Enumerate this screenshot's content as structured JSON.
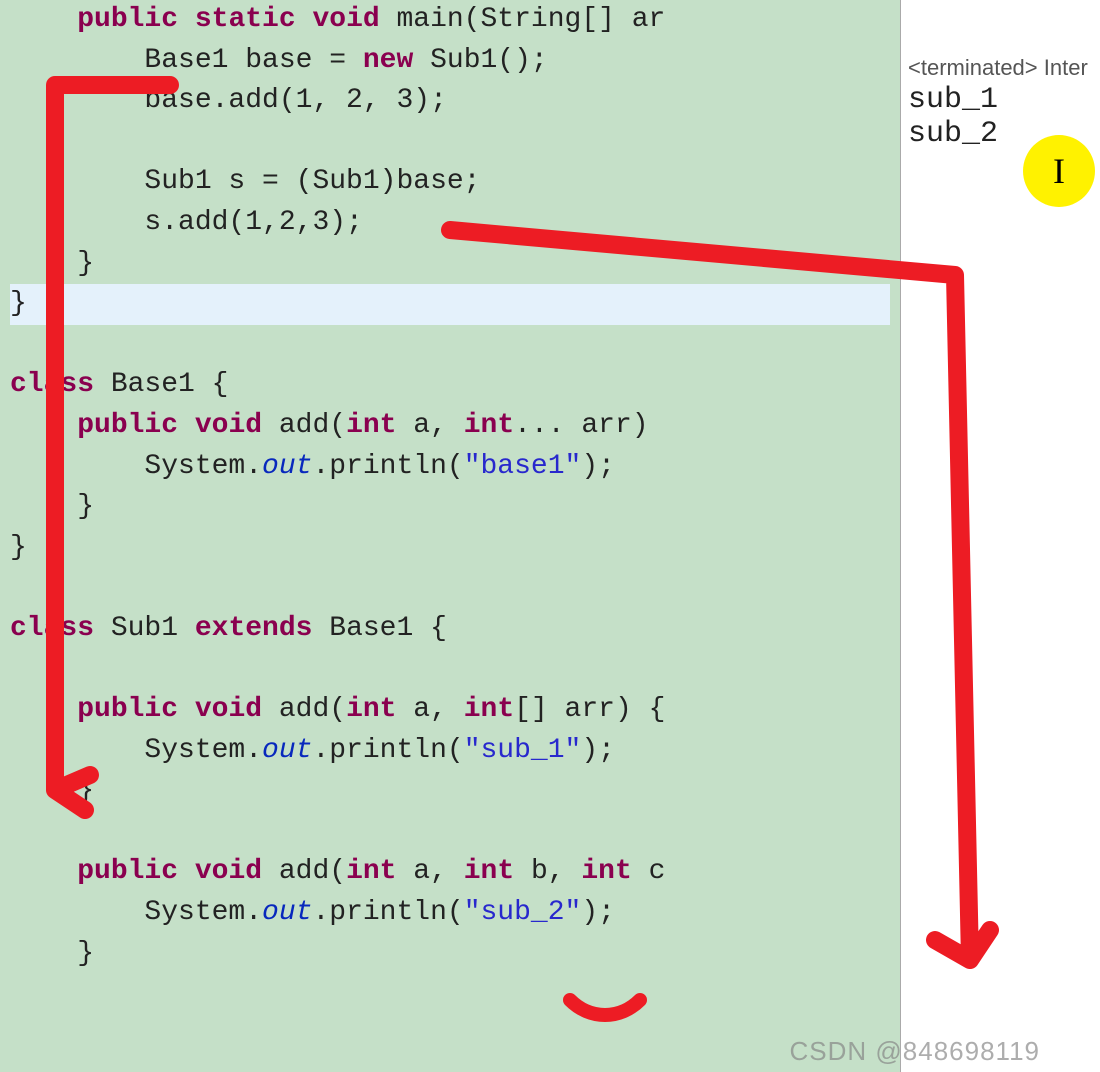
{
  "code": {
    "line1_t1": "    ",
    "line1_kw1": "public static void",
    "line1_t2": " main(String[] ar",
    "line2_t1": "        Base1 base = ",
    "line2_kw1": "new",
    "line2_t2": " Sub1();",
    "line3_t1": "        base.add(1, 2, 3);",
    "line4_t1": "",
    "line5_t1": "        Sub1 s = (Sub1)base;",
    "line6_t1": "        s.add(1,2,3);",
    "line7_t1": "    }",
    "line8_t1": "}",
    "line9_t1": "",
    "line10_kw1": "class",
    "line10_t1": " Base1 {",
    "line11_t1": "    ",
    "line11_kw1": "public void",
    "line11_t2": " add(",
    "line11_kw2": "int",
    "line11_t3": " a, ",
    "line11_kw3": "int",
    "line11_t4": "... arr)",
    "line12_t1": "        System.",
    "line12_f1": "out",
    "line12_t2": ".println(",
    "line12_s1": "\"base1\"",
    "line12_t3": ");",
    "line13_t1": "    }",
    "line14_t1": "}",
    "line15_t1": "",
    "line16_kw1": "class",
    "line16_t1": " Sub1 ",
    "line16_kw2": "extends",
    "line16_t2": " Base1 {",
    "line17_t1": "",
    "line18_t1": "    ",
    "line18_kw1": "public void",
    "line18_t2": " add(",
    "line18_kw2": "int",
    "line18_t3": " a, ",
    "line18_kw3": "int",
    "line18_t4": "[] arr) {",
    "line19_t1": "        System.",
    "line19_f1": "out",
    "line19_t2": ".println(",
    "line19_s1": "\"sub_1\"",
    "line19_t3": ");",
    "line20_t1": "    }",
    "line21_t1": "",
    "line22_t1": "    ",
    "line22_kw1": "public void",
    "line22_t2": " add(",
    "line22_kw2": "int",
    "line22_t3": " a, ",
    "line22_kw3": "int",
    "line22_t4": " b, ",
    "line22_kw4": "int",
    "line22_t5": " c",
    "line23_t1": "        System.",
    "line23_f1": "out",
    "line23_t2": ".println(",
    "line23_s1": "\"sub_2\"",
    "line23_t3": ");",
    "line24_t1": "    }"
  },
  "console": {
    "status": "<terminated> Inter",
    "output_line1": "sub_1",
    "output_line2": "sub_2"
  },
  "cursor_marker": "I",
  "watermark": "CSDN @848698119"
}
